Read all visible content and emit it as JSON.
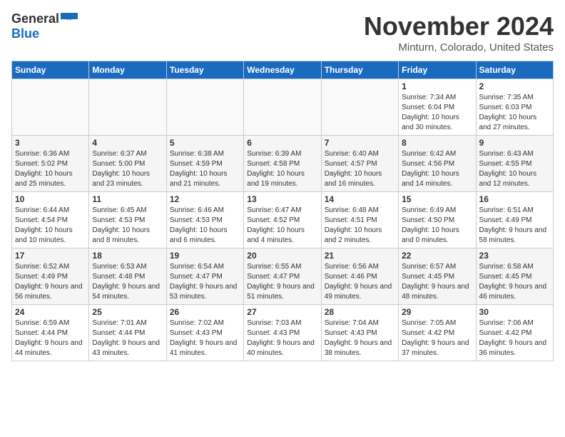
{
  "logo": {
    "general": "General",
    "blue": "Blue"
  },
  "title": "November 2024",
  "location": "Minturn, Colorado, United States",
  "weekdays": [
    "Sunday",
    "Monday",
    "Tuesday",
    "Wednesday",
    "Thursday",
    "Friday",
    "Saturday"
  ],
  "weeks": [
    [
      {
        "day": "",
        "info": ""
      },
      {
        "day": "",
        "info": ""
      },
      {
        "day": "",
        "info": ""
      },
      {
        "day": "",
        "info": ""
      },
      {
        "day": "",
        "info": ""
      },
      {
        "day": "1",
        "info": "Sunrise: 7:34 AM\nSunset: 6:04 PM\nDaylight: 10 hours and 30 minutes."
      },
      {
        "day": "2",
        "info": "Sunrise: 7:35 AM\nSunset: 6:03 PM\nDaylight: 10 hours and 27 minutes."
      }
    ],
    [
      {
        "day": "3",
        "info": "Sunrise: 6:36 AM\nSunset: 5:02 PM\nDaylight: 10 hours and 25 minutes."
      },
      {
        "day": "4",
        "info": "Sunrise: 6:37 AM\nSunset: 5:00 PM\nDaylight: 10 hours and 23 minutes."
      },
      {
        "day": "5",
        "info": "Sunrise: 6:38 AM\nSunset: 4:59 PM\nDaylight: 10 hours and 21 minutes."
      },
      {
        "day": "6",
        "info": "Sunrise: 6:39 AM\nSunset: 4:58 PM\nDaylight: 10 hours and 19 minutes."
      },
      {
        "day": "7",
        "info": "Sunrise: 6:40 AM\nSunset: 4:57 PM\nDaylight: 10 hours and 16 minutes."
      },
      {
        "day": "8",
        "info": "Sunrise: 6:42 AM\nSunset: 4:56 PM\nDaylight: 10 hours and 14 minutes."
      },
      {
        "day": "9",
        "info": "Sunrise: 6:43 AM\nSunset: 4:55 PM\nDaylight: 10 hours and 12 minutes."
      }
    ],
    [
      {
        "day": "10",
        "info": "Sunrise: 6:44 AM\nSunset: 4:54 PM\nDaylight: 10 hours and 10 minutes."
      },
      {
        "day": "11",
        "info": "Sunrise: 6:45 AM\nSunset: 4:53 PM\nDaylight: 10 hours and 8 minutes."
      },
      {
        "day": "12",
        "info": "Sunrise: 6:46 AM\nSunset: 4:53 PM\nDaylight: 10 hours and 6 minutes."
      },
      {
        "day": "13",
        "info": "Sunrise: 6:47 AM\nSunset: 4:52 PM\nDaylight: 10 hours and 4 minutes."
      },
      {
        "day": "14",
        "info": "Sunrise: 6:48 AM\nSunset: 4:51 PM\nDaylight: 10 hours and 2 minutes."
      },
      {
        "day": "15",
        "info": "Sunrise: 6:49 AM\nSunset: 4:50 PM\nDaylight: 10 hours and 0 minutes."
      },
      {
        "day": "16",
        "info": "Sunrise: 6:51 AM\nSunset: 4:49 PM\nDaylight: 9 hours and 58 minutes."
      }
    ],
    [
      {
        "day": "17",
        "info": "Sunrise: 6:52 AM\nSunset: 4:49 PM\nDaylight: 9 hours and 56 minutes."
      },
      {
        "day": "18",
        "info": "Sunrise: 6:53 AM\nSunset: 4:48 PM\nDaylight: 9 hours and 54 minutes."
      },
      {
        "day": "19",
        "info": "Sunrise: 6:54 AM\nSunset: 4:47 PM\nDaylight: 9 hours and 53 minutes."
      },
      {
        "day": "20",
        "info": "Sunrise: 6:55 AM\nSunset: 4:47 PM\nDaylight: 9 hours and 51 minutes."
      },
      {
        "day": "21",
        "info": "Sunrise: 6:56 AM\nSunset: 4:46 PM\nDaylight: 9 hours and 49 minutes."
      },
      {
        "day": "22",
        "info": "Sunrise: 6:57 AM\nSunset: 4:45 PM\nDaylight: 9 hours and 48 minutes."
      },
      {
        "day": "23",
        "info": "Sunrise: 6:58 AM\nSunset: 4:45 PM\nDaylight: 9 hours and 46 minutes."
      }
    ],
    [
      {
        "day": "24",
        "info": "Sunrise: 6:59 AM\nSunset: 4:44 PM\nDaylight: 9 hours and 44 minutes."
      },
      {
        "day": "25",
        "info": "Sunrise: 7:01 AM\nSunset: 4:44 PM\nDaylight: 9 hours and 43 minutes."
      },
      {
        "day": "26",
        "info": "Sunrise: 7:02 AM\nSunset: 4:43 PM\nDaylight: 9 hours and 41 minutes."
      },
      {
        "day": "27",
        "info": "Sunrise: 7:03 AM\nSunset: 4:43 PM\nDaylight: 9 hours and 40 minutes."
      },
      {
        "day": "28",
        "info": "Sunrise: 7:04 AM\nSunset: 4:43 PM\nDaylight: 9 hours and 38 minutes."
      },
      {
        "day": "29",
        "info": "Sunrise: 7:05 AM\nSunset: 4:42 PM\nDaylight: 9 hours and 37 minutes."
      },
      {
        "day": "30",
        "info": "Sunrise: 7:06 AM\nSunset: 4:42 PM\nDaylight: 9 hours and 36 minutes."
      }
    ]
  ]
}
